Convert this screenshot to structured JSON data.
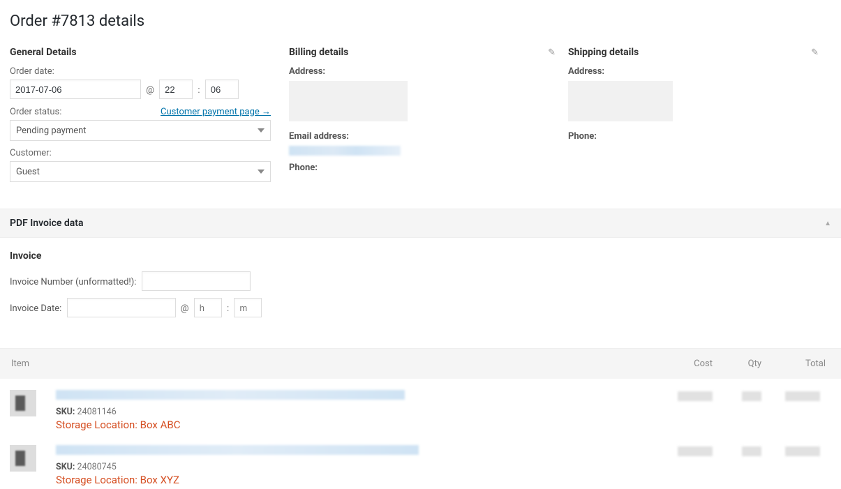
{
  "order": {
    "title": "Order #7813 details"
  },
  "general": {
    "heading": "General Details",
    "order_date_label": "Order date:",
    "order_date": "2017-07-06",
    "at_symbol": "@",
    "hour": "22",
    "time_sep": ":",
    "minute": "06",
    "order_status_label": "Order status:",
    "payment_page_link": "Customer payment page →",
    "status_value": "Pending payment",
    "customer_label": "Customer:",
    "customer_value": "Guest"
  },
  "billing": {
    "heading": "Billing details",
    "address_label": "Address:",
    "email_label": "Email address:",
    "phone_label": "Phone:"
  },
  "shipping": {
    "heading": "Shipping details",
    "address_label": "Address:",
    "phone_label": "Phone:"
  },
  "pdf_panel": {
    "title": "PDF Invoice data",
    "invoice_heading": "Invoice",
    "number_label": "Invoice Number (unformatted!):",
    "number_value": "",
    "date_label": "Invoice Date:",
    "date_value": "",
    "at_symbol": "@",
    "hour_placeholder": "h",
    "time_sep": ":",
    "minute_placeholder": "m"
  },
  "items_header": {
    "item": "Item",
    "cost": "Cost",
    "qty": "Qty",
    "total": "Total"
  },
  "items": [
    {
      "sku_label": "SKU:",
      "sku": "24081146",
      "storage": "Storage Location: Box ABC"
    },
    {
      "sku_label": "SKU:",
      "sku": "24080745",
      "storage": "Storage Location: Box XYZ"
    }
  ]
}
